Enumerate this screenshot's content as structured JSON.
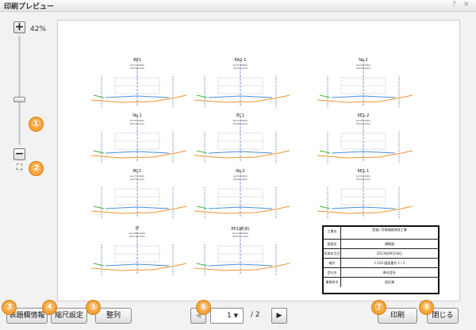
{
  "window": {
    "title": "印刷プレビュー",
    "help_icon": "?",
    "close_icon": "✕"
  },
  "zoom": {
    "label": "42%",
    "level_percent": 42,
    "zoom_in": "+",
    "zoom_out": "−",
    "fit": "⛶"
  },
  "markers": [
    "①",
    "②",
    "③",
    "④",
    "⑤",
    "⑥",
    "⑦",
    "⑧"
  ],
  "sections": [
    {
      "title": "BP1",
      "sub": "IA=1 0.00m\nGH=1 4.0m"
    },
    {
      "title": "KA2-1",
      "sub": "IA=2 0.00m\nGH=2 4.0m"
    },
    {
      "title": "No.2",
      "sub": "IA=3 0.00m\nGH=3 4.0m"
    },
    {
      "title": "No.1",
      "sub": "IA=4 0.00m\nGH=4 4.0m"
    },
    {
      "title": "EC1",
      "sub": "IA=5 0.00m\nGH=5 4.0m"
    },
    {
      "title": "KE1-2",
      "sub": "IA=6 0.00m\nGH=6 4.0m"
    },
    {
      "title": "BC1",
      "sub": "IA=7 0.00m\nGH=7 4.0m"
    },
    {
      "title": "No.2",
      "sub": "IA=8 0.00m\nGH=8 4.0m"
    },
    {
      "title": "KE1-1",
      "sub": "IA=9 0.00m\nGH=9 4.0m"
    },
    {
      "title": "IP",
      "sub": "IA=10 0.00m\nGH=10 4.0m"
    },
    {
      "title": "EP1(終点)",
      "sub": "IA=11 0.00m\nGH=11 4.0m"
    }
  ],
  "title_block": {
    "rows": [
      {
        "label": "工事名",
        "value": "国道○号線道路改良工事"
      },
      {
        "label": "図面名",
        "value": "横断図"
      },
      {
        "label": "作成年月日",
        "value": "2013年09月18日"
      },
      {
        "label": "縮尺",
        "value": "1:150    図面番号    1 / 2"
      },
      {
        "label": "会社名",
        "value": "株式会社"
      },
      {
        "label": "事務所名",
        "value": "設計課"
      }
    ]
  },
  "footer": {
    "survey_info_button": "表題欄情報",
    "scale_setting_button": "縮尺設定",
    "arrange_button": "整列",
    "prev_page": "◀",
    "page_value": "1",
    "page_total": "/ 2",
    "next_page": "▶",
    "print_button": "印刷",
    "close_button": "閉じる"
  }
}
